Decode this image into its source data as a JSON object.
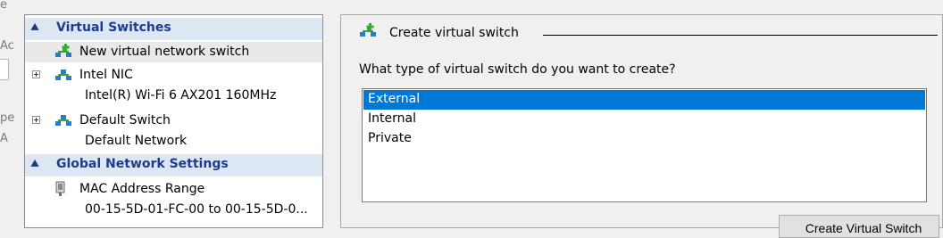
{
  "background_fragments": [
    "e",
    "Ac",
    "pe",
    "A"
  ],
  "left_panel": {
    "virtual_switches": {
      "header": "Virtual Switches",
      "new_switch": "New virtual network switch",
      "switches": [
        {
          "name": "Intel NIC",
          "detail": "Intel(R) Wi-Fi 6 AX201 160MHz"
        },
        {
          "name": "Default Switch",
          "detail": "Default Network"
        }
      ]
    },
    "global_settings": {
      "header": "Global Network Settings",
      "mac_range": {
        "name": "MAC Address Range",
        "detail": "00-15-5D-01-FC-00 to 00-15-5D-0..."
      }
    }
  },
  "right_panel": {
    "title": "Create virtual switch",
    "question": "What type of virtual switch do you want to create?",
    "types": [
      "External",
      "Internal",
      "Private"
    ],
    "selected_type": "External",
    "create_button": "Create Virtual Switch"
  },
  "colors": {
    "selection": "#0078d7",
    "section_header_bg": "#dde7f3",
    "section_header_text": "#1e3c8c"
  }
}
